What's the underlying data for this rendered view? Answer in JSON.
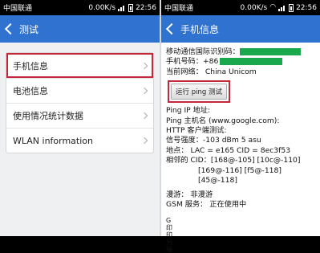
{
  "left": {
    "status": {
      "carrier": "中国联通",
      "speed": "0.00K/s",
      "time": "22:56"
    },
    "title": "测试",
    "items": [
      {
        "label": "手机信息"
      },
      {
        "label": "电池信息"
      },
      {
        "label": "使用情况统计数据"
      },
      {
        "label": "WLAN information"
      }
    ]
  },
  "right": {
    "status": {
      "carrier": "中国联通",
      "speed": "0.00K/s",
      "time": "22:56"
    },
    "title": "手机信息",
    "imsi_label": "移动通信国际识别码：",
    "phone_label": "手机号码：",
    "phone_prefix": "+86",
    "network_label": "当前网络：",
    "network_value": "China Unicom",
    "ping_button": "运行 ping 测试",
    "ping_ip": "Ping IP 地址:",
    "ping_host": "Ping 主机名 (www.google.com):",
    "http_test": "HTTP 客户端测试:",
    "signal": "信号强度：-103 dBm  5 asu",
    "location": "地点： LAC = e165  CID = 8ec3f53",
    "neighbor_label": "相邻的 CID：",
    "neighbor_cids": [
      "[168@-105] [10c@-110]",
      "[169@-116] [f5@-118]",
      "[45@-118]"
    ],
    "roaming": "漫游：  非漫游",
    "gsm": "GSM 服务：  正在使用中",
    "cutoff_chars": "G\n印\n印\n另\n服"
  }
}
